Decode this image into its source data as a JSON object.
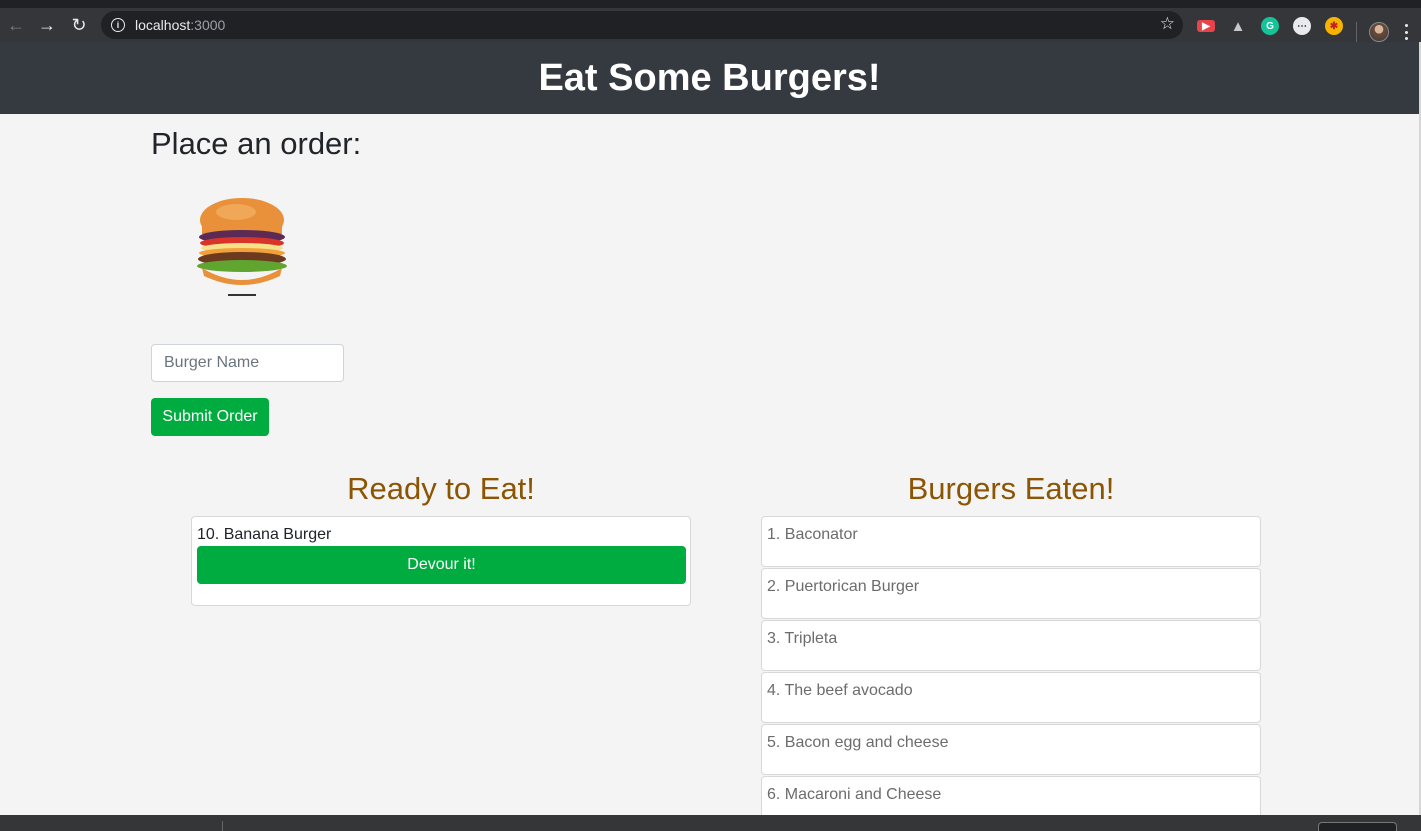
{
  "browser": {
    "url_host": "localhost",
    "url_port": ":3000",
    "icons": [
      "back-arrow-icon",
      "forward-arrow-icon",
      "reload-icon",
      "info-icon",
      "star-icon",
      "extension-icon",
      "avatar",
      "menu-icon"
    ]
  },
  "header": {
    "title": "Eat Some Burgers!"
  },
  "order": {
    "title": "Place an order:",
    "input_placeholder": "Burger Name",
    "submit_label": "Submit Order"
  },
  "ready": {
    "title": "Ready to Eat!",
    "items": [
      {
        "label": "10. Banana Burger",
        "button": "Devour it!"
      }
    ]
  },
  "eaten": {
    "title": "Burgers Eaten!",
    "items": [
      "1. Baconator",
      "2. Puertorican Burger",
      "3. Tripleta",
      "4. The beef avocado",
      "5. Bacon egg and cheese",
      "6. Macaroni and Cheese"
    ]
  },
  "colors": {
    "header_bg": "#343a40",
    "accent_green": "#00ac3f",
    "title_brown": "#8b5504"
  }
}
